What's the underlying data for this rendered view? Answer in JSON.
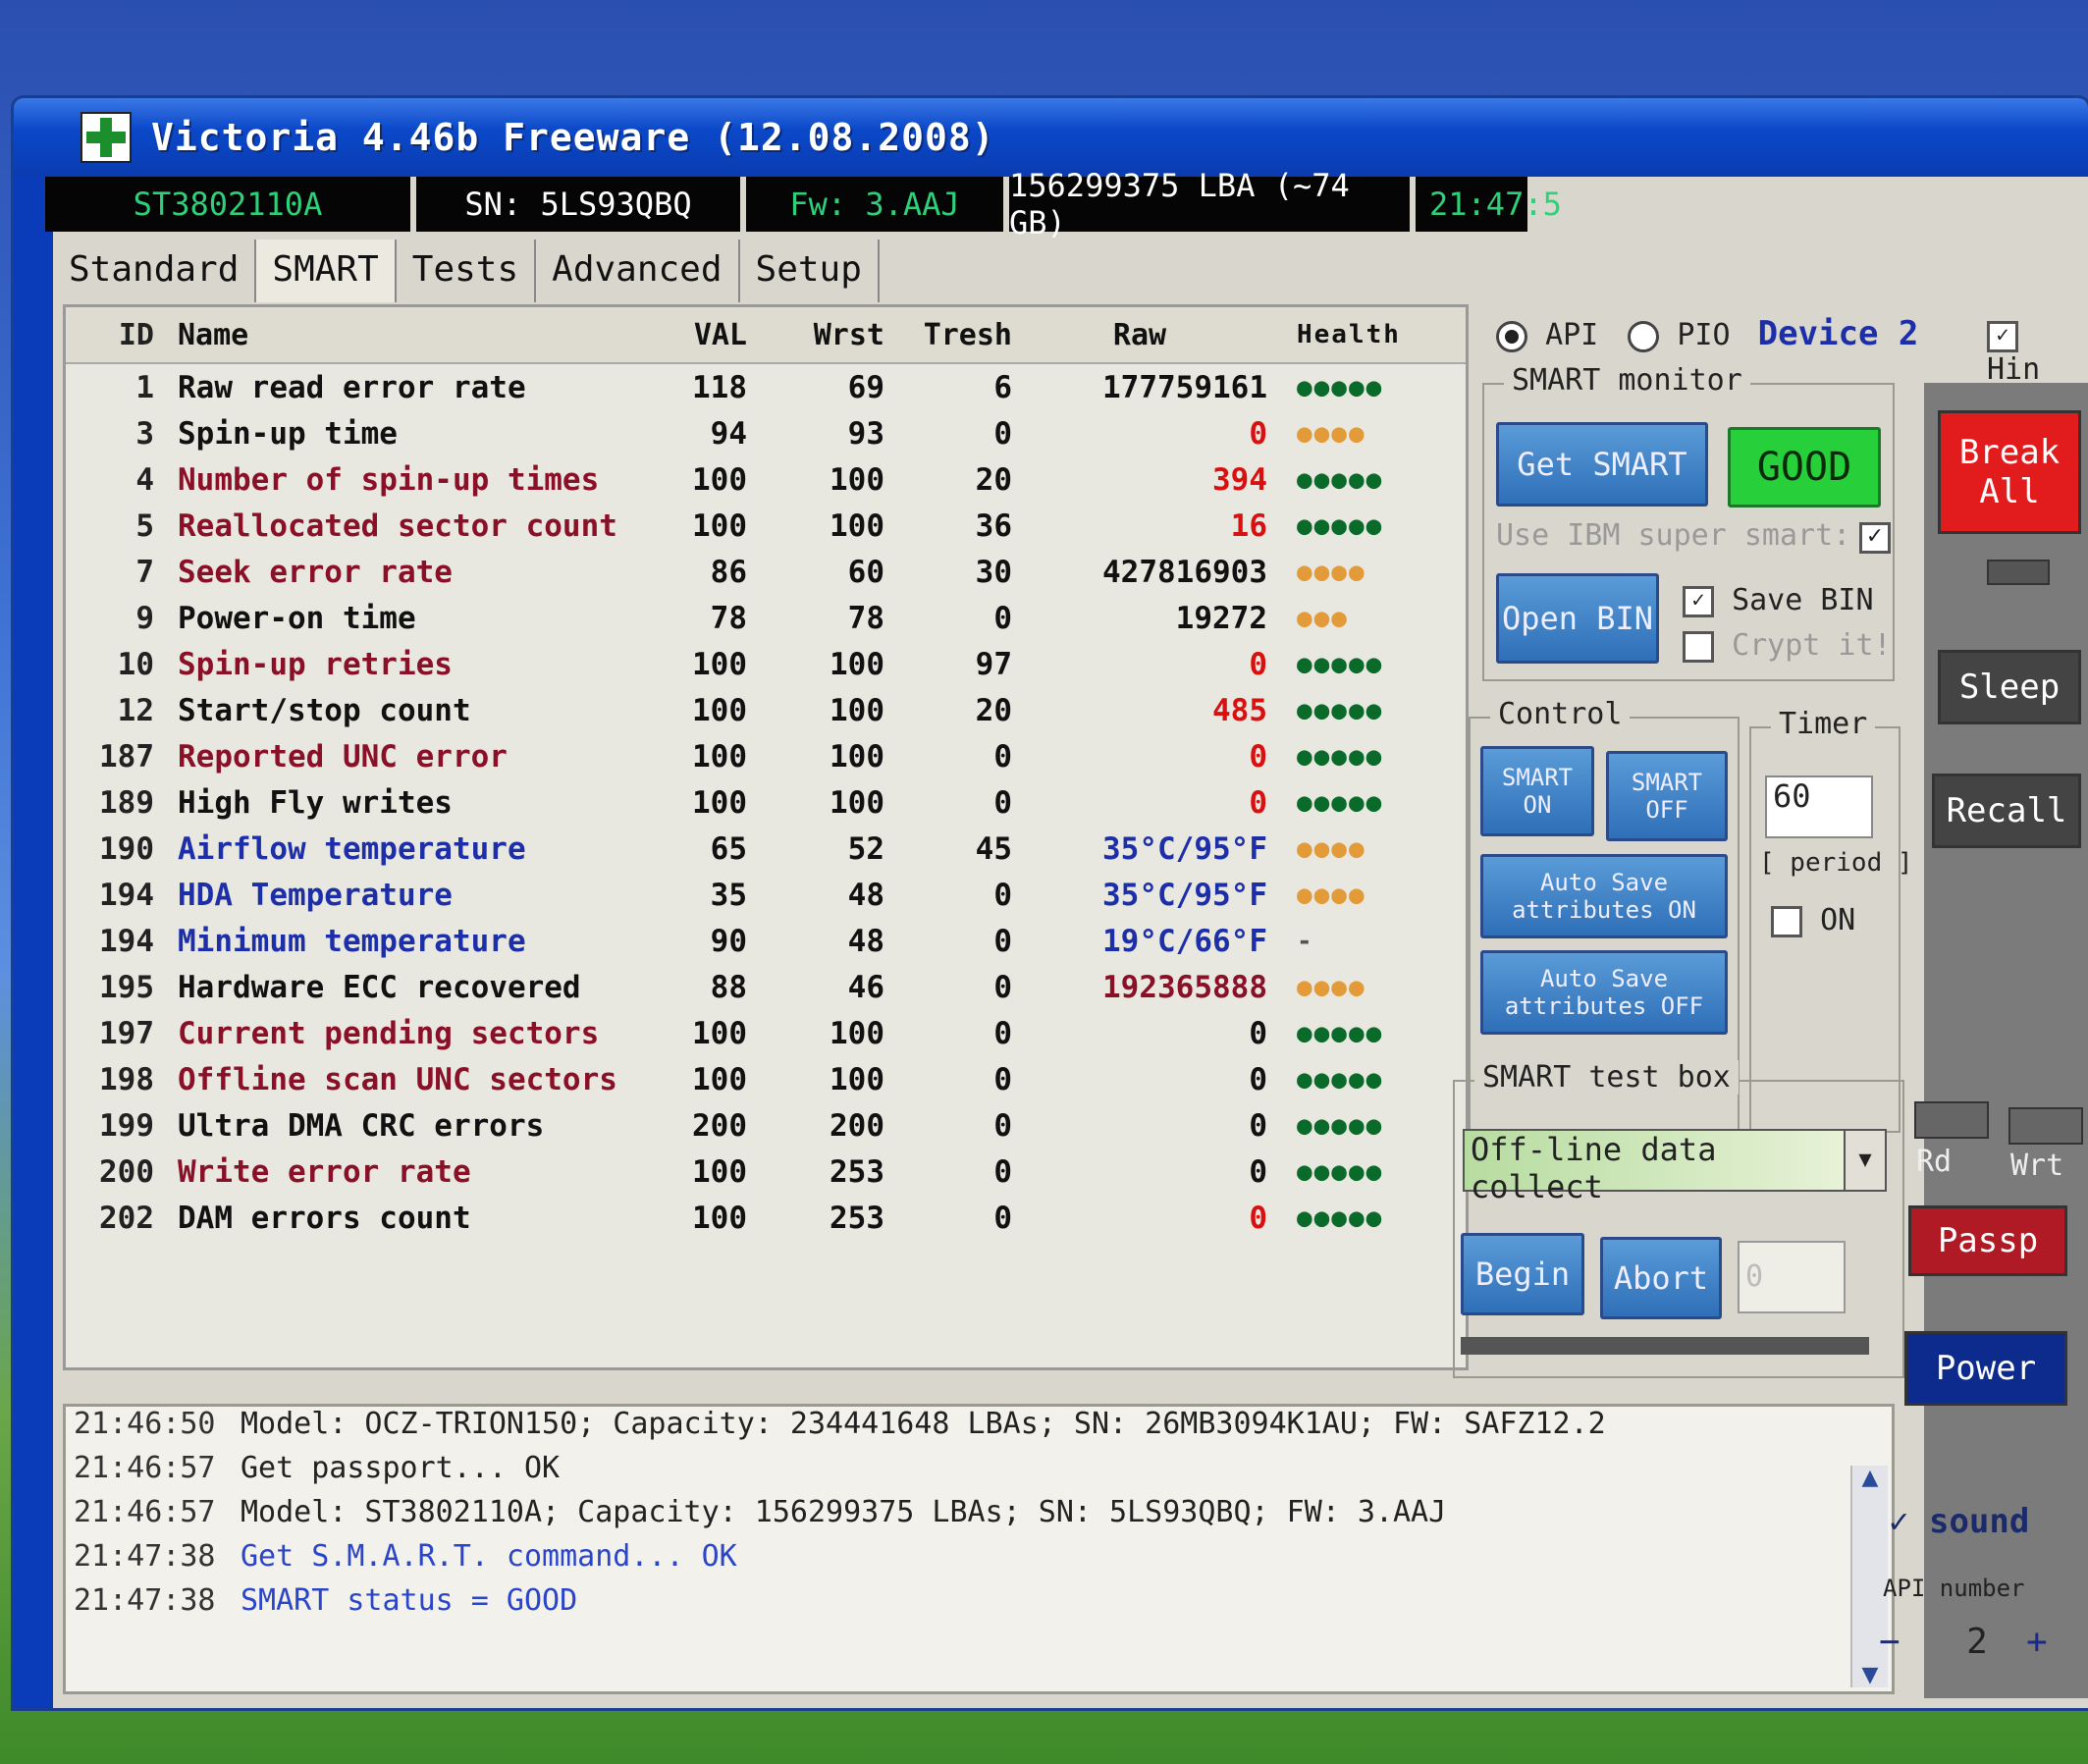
{
  "window": {
    "title": "Victoria 4.46b Freeware (12.08.2008)",
    "clock": "21:47:5"
  },
  "infobar": {
    "model": "ST3802110A",
    "serial": "SN: 5LS93QBQ",
    "firmware": "Fw: 3.AAJ",
    "lba": "156299375 LBA (~74 GB)"
  },
  "tabs": [
    "Standard",
    "SMART",
    "Tests",
    "Advanced",
    "Setup"
  ],
  "table": {
    "headers": {
      "id": "ID",
      "name": "Name",
      "val": "VAL",
      "wrst": "Wrst",
      "tresh": "Tresh",
      "raw": "Raw",
      "health": "Health"
    },
    "rows": [
      {
        "id": "1",
        "name": "Raw read error rate",
        "val": "118",
        "wrst": "69",
        "tresh": "6",
        "raw": "177759161",
        "health": "●●●●●"
      },
      {
        "id": "3",
        "name": "Spin-up time",
        "val": "94",
        "wrst": "93",
        "tresh": "0",
        "raw": "0",
        "health": "●●●●"
      },
      {
        "id": "4",
        "name": "Number of spin-up times",
        "val": "100",
        "wrst": "100",
        "tresh": "20",
        "raw": "394",
        "health": "●●●●●"
      },
      {
        "id": "5",
        "name": "Reallocated sector count",
        "val": "100",
        "wrst": "100",
        "tresh": "36",
        "raw": "16",
        "health": "●●●●●"
      },
      {
        "id": "7",
        "name": "Seek error rate",
        "val": "86",
        "wrst": "60",
        "tresh": "30",
        "raw": "427816903",
        "health": "●●●●"
      },
      {
        "id": "9",
        "name": "Power-on time",
        "val": "78",
        "wrst": "78",
        "tresh": "0",
        "raw": "19272",
        "health": "●●●"
      },
      {
        "id": "10",
        "name": "Spin-up retries",
        "val": "100",
        "wrst": "100",
        "tresh": "97",
        "raw": "0",
        "health": "●●●●●"
      },
      {
        "id": "12",
        "name": "Start/stop count",
        "val": "100",
        "wrst": "100",
        "tresh": "20",
        "raw": "485",
        "health": "●●●●●"
      },
      {
        "id": "187",
        "name": "Reported UNC error",
        "val": "100",
        "wrst": "100",
        "tresh": "0",
        "raw": "0",
        "health": "●●●●●"
      },
      {
        "id": "189",
        "name": "High Fly writes",
        "val": "100",
        "wrst": "100",
        "tresh": "0",
        "raw": "0",
        "health": "●●●●●"
      },
      {
        "id": "190",
        "name": "Airflow temperature",
        "val": "65",
        "wrst": "52",
        "tresh": "45",
        "raw": "35°C/95°F",
        "health": "●●●●"
      },
      {
        "id": "194",
        "name": "HDA Temperature",
        "val": "35",
        "wrst": "48",
        "tresh": "0",
        "raw": "35°C/95°F",
        "health": "●●●●"
      },
      {
        "id": "194",
        "name": "Minimum temperature",
        "val": "90",
        "wrst": "48",
        "tresh": "0",
        "raw": "19°C/66°F",
        "health": "-"
      },
      {
        "id": "195",
        "name": "Hardware ECC recovered",
        "val": "88",
        "wrst": "46",
        "tresh": "0",
        "raw": "192365888",
        "health": "●●●●"
      },
      {
        "id": "197",
        "name": "Current pending sectors",
        "val": "100",
        "wrst": "100",
        "tresh": "0",
        "raw": "0",
        "health": "●●●●●"
      },
      {
        "id": "198",
        "name": "Offline scan UNC sectors",
        "val": "100",
        "wrst": "100",
        "tresh": "0",
        "raw": "0",
        "health": "●●●●●"
      },
      {
        "id": "199",
        "name": "Ultra DMA CRC errors",
        "val": "200",
        "wrst": "200",
        "tresh": "0",
        "raw": "0",
        "health": "●●●●●"
      },
      {
        "id": "200",
        "name": "Write error rate",
        "val": "100",
        "wrst": "253",
        "tresh": "0",
        "raw": "0",
        "health": "●●●●●"
      },
      {
        "id": "202",
        "name": "DAM errors count",
        "val": "100",
        "wrst": "253",
        "tresh": "0",
        "raw": "0",
        "health": "●●●●●"
      }
    ]
  },
  "mode": {
    "api": "API",
    "pio": "PIO",
    "device": "Device 2",
    "hints": "Hin"
  },
  "smart_monitor": {
    "title": "SMART monitor",
    "get_smart": "Get SMART",
    "status": "GOOD",
    "ibm_label": "Use IBM super smart:",
    "open_bin": "Open BIN",
    "save_bin": "Save BIN",
    "crypt": "Crypt it!"
  },
  "control": {
    "title": "Control",
    "smart_on": "SMART ON",
    "smart_off": "SMART OFF",
    "autosave_on": "Auto Save attributes ON",
    "autosave_off": "Auto Save attributes OFF"
  },
  "timer": {
    "title": "Timer",
    "value": "60",
    "period_label": "[ period ]",
    "on_label": "ON"
  },
  "test_box": {
    "title": "SMART test box",
    "selected": "Off-line data collect",
    "begin": "Begin",
    "abort": "Abort",
    "value": "0"
  },
  "sidebar": {
    "break_all": "Break All",
    "sleep": "Sleep",
    "recall": "Recall",
    "rd": "Rd",
    "wrt": "Wrt",
    "passp": "Passp",
    "power": "Power",
    "sound": "sound",
    "api_number_label": "API number",
    "api_number": "2",
    "minus": "−",
    "plus": "+"
  },
  "log": [
    {
      "time": "21:46:50",
      "msg": "Model: OCZ-TRION150; Capacity: 234441648 LBAs; SN: 26MB3094K1AU; FW: SAFZ12.2",
      "color": "black"
    },
    {
      "time": "21:46:57",
      "msg": "Get passport... OK",
      "color": "black"
    },
    {
      "time": "21:46:57",
      "msg": "Model: ST3802110A; Capacity: 156299375 LBAs; SN: 5LS93QBQ; FW: 3.AAJ",
      "color": "black"
    },
    {
      "time": "21:47:38",
      "msg": "Get S.M.A.R.T. command... OK",
      "color": "blue"
    },
    {
      "time": "21:47:38",
      "msg": "SMART status = GOOD",
      "color": "blue"
    }
  ],
  "row_styles": {
    "name_colors": [
      "blk",
      "blk",
      "red",
      "red",
      "red",
      "blk",
      "red",
      "blk",
      "red",
      "blk",
      "blu",
      "blu",
      "blu",
      "blk",
      "red",
      "red",
      "blk",
      "red",
      "blk"
    ],
    "raw_colors": [
      "blk",
      "red",
      "red",
      "red",
      "blk",
      "blk",
      "red",
      "red",
      "red",
      "red",
      "blu",
      "blu",
      "blu",
      "dark",
      "blk",
      "blk",
      "blk",
      "blk",
      "red"
    ],
    "health_colors": [
      "green",
      "orange",
      "green",
      "green",
      "orange",
      "orange",
      "green",
      "green",
      "green",
      "green",
      "orange",
      "orange",
      "none",
      "orange",
      "green",
      "green",
      "green",
      "green",
      "green"
    ]
  }
}
